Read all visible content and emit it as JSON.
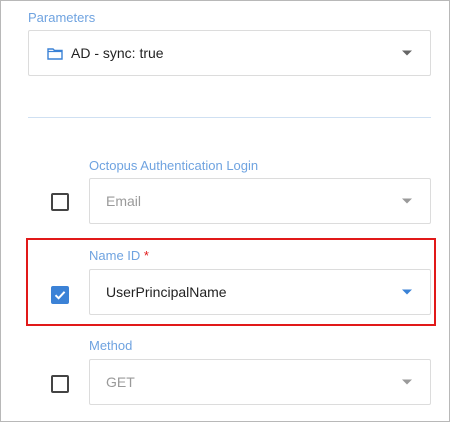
{
  "parameters": {
    "label": "Parameters",
    "selected": "AD - sync: true",
    "icon": "folder-icon"
  },
  "octopus_login": {
    "label": "Octopus Authentication Login",
    "checked": false,
    "value": "Email"
  },
  "name_id": {
    "label": "Name ID",
    "required_marker": "*",
    "checked": true,
    "value": "UserPrincipalName"
  },
  "method": {
    "label": "Method",
    "checked": false,
    "value": "GET"
  },
  "colors": {
    "accent": "#3b82d6",
    "label": "#6fa3e0",
    "highlight": "#e11919"
  }
}
